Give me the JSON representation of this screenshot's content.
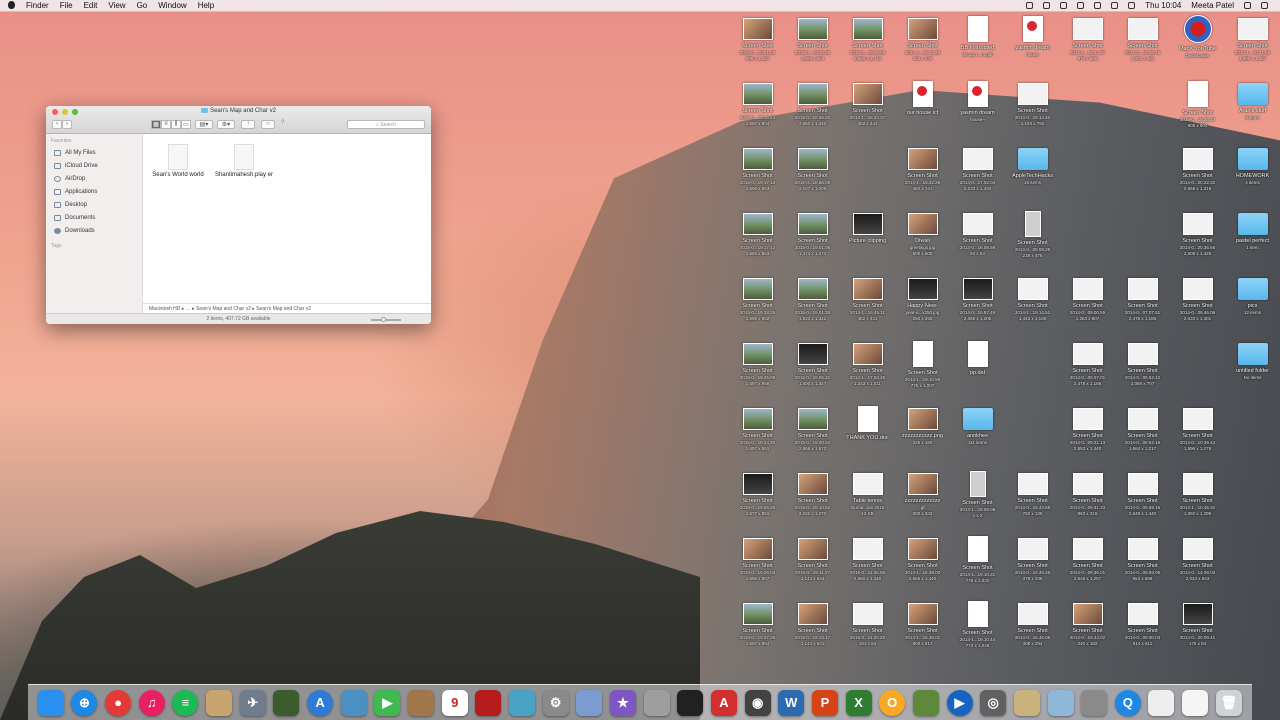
{
  "menubar": {
    "items": [
      "Finder",
      "File",
      "Edit",
      "View",
      "Go",
      "Window",
      "Help"
    ],
    "clock": "Thu 10:04",
    "user": "Meeta Patel"
  },
  "finder": {
    "title": "Sean's Map and Char v2",
    "search_placeholder": "Search",
    "sidebar": {
      "favorites_label": "Favorites",
      "items": [
        "All My Files",
        "iCloud Drive",
        "AirDrop",
        "Applications",
        "Desktop",
        "Documents",
        "Downloads"
      ],
      "tags_label": "Tags"
    },
    "files": [
      "Sean's World world",
      "Shantimahesh.play er"
    ],
    "path": [
      "Macintosh HD",
      "Sean's Map and Char v2",
      "Sean's Map and Char v2"
    ],
    "status": "2 items, 407.72 GB available"
  },
  "desktop_icons": [
    {
      "name": "Screen Shot",
      "sub": "2015-0...20.01.26",
      "dims": "690 x 1,224",
      "kind": "photo"
    },
    {
      "name": "Screen Shot",
      "sub": "2015-0...19.18.25",
      "dims": "1,692 x 954",
      "kind": "screen"
    },
    {
      "name": "Screen Shot",
      "sub": "2015-0...19.19.09",
      "dims": "2,560 x 1,440",
      "kind": "screen"
    },
    {
      "name": "Screen Shot",
      "sub": "2014-1...16.42.28",
      "dims": "482 x 445",
      "kind": "photo"
    },
    {
      "name": "BB Instructed",
      "sub": "Group I...m.pdf",
      "dims": "",
      "kind": "doc"
    },
    {
      "name": "yasmin dream",
      "sub": "house",
      "dims": "",
      "kind": "skp"
    },
    {
      "name": "Screen Shot",
      "sub": "2014-1...16.14.37",
      "dims": "978 x 566",
      "kind": "white"
    },
    {
      "name": "Screen Shot",
      "sub": "2014-0...19.36.45",
      "dims": "1,002 x 482",
      "kind": "white"
    },
    {
      "name": "MacX YouTube",
      "sub": "Downloader",
      "dims": "",
      "kind": "yt"
    },
    {
      "name": "Screen Shot",
      "sub": "2014-1...10.31.58",
      "dims": "1,596 x 1,287",
      "kind": "white"
    },
    {
      "name": "Screen Shot",
      "sub": "2015-0...19.16.54",
      "dims": "1,697 x 904",
      "kind": "screen"
    },
    {
      "name": "Screen Shot",
      "sub": "2015-0...18.55.22",
      "dims": "2,560 x 1,440",
      "kind": "screen"
    },
    {
      "name": "Screen Shot",
      "sub": "2014-1...16.44.37",
      "dims": "482 x 444",
      "kind": "photo"
    },
    {
      "name": "our house ict",
      "sub": "",
      "dims": "",
      "kind": "skp"
    },
    {
      "name": "yasmin dream",
      "sub": "house~",
      "dims": "",
      "kind": "skp"
    },
    {
      "name": "Screen Shot",
      "sub": "2014-0...19.14.40",
      "dims": "1,163 x 792",
      "kind": "white"
    },
    {
      "name": "",
      "sub": "",
      "dims": "",
      "kind": "empty"
    },
    {
      "name": "",
      "sub": "",
      "dims": "",
      "kind": "empty"
    },
    {
      "name": "Screen Shot",
      "sub": "2015-0...15.36.37",
      "dims": "908 x 904",
      "kind": "doc"
    },
    {
      "name": "Aran's stuff",
      "sub": "9 items",
      "dims": "",
      "kind": "folder"
    },
    {
      "name": "Screen Shot",
      "sub": "2015-0...19.17.13",
      "dims": "1,696 x 953",
      "kind": "screen"
    },
    {
      "name": "Screen Shot",
      "sub": "2015-0...18.56.08",
      "dims": "2,107 x 1,209",
      "kind": "screen"
    },
    {
      "name": "",
      "sub": "",
      "dims": "",
      "kind": "empty"
    },
    {
      "name": "Screen Shot",
      "sub": "2014-1...16.42.26",
      "dims": "482 x 741",
      "kind": "photo"
    },
    {
      "name": "Screen Shot",
      "sub": "2014-0...17.02.04",
      "dims": "2,033 x 1,433",
      "kind": "white"
    },
    {
      "name": "AppleTechHacks",
      "sub": "15 items",
      "dims": "",
      "kind": "folder"
    },
    {
      "name": "",
      "sub": "",
      "dims": "",
      "kind": "empty"
    },
    {
      "name": "",
      "sub": "",
      "dims": "",
      "kind": "empty"
    },
    {
      "name": "Screen Shot",
      "sub": "2014-0...20.22.32",
      "dims": "2,658 x 1,319",
      "kind": "white"
    },
    {
      "name": "HOMEWORK",
      "sub": "4 items",
      "dims": "",
      "kind": "folder"
    },
    {
      "name": "Screen Shot",
      "sub": "2015-0...19.17.42",
      "dims": "1,696 x 953",
      "kind": "screen"
    },
    {
      "name": "Screen Shot",
      "sub": "2015-0...19.01.06",
      "dims": "1,474 x 1,273",
      "kind": "screen"
    },
    {
      "name": "Picture clipping",
      "sub": "",
      "dims": "",
      "kind": "dark"
    },
    {
      "name": "Diwali",
      "sub": "greetings.jpg",
      "dims": "500 x 500",
      "kind": "photo"
    },
    {
      "name": "Screen Shot",
      "sub": "2014-0...16.08.58",
      "dims": "94 x 54",
      "kind": "white"
    },
    {
      "name": "Screen Shot",
      "sub": "2014-0...09.08.28",
      "dims": "238 x 475",
      "kind": "tall"
    },
    {
      "name": "",
      "sub": "",
      "dims": "",
      "kind": "empty"
    },
    {
      "name": "",
      "sub": "",
      "dims": "",
      "kind": "empty"
    },
    {
      "name": "Screen Shot",
      "sub": "2014-0...20.36.56",
      "dims": "2,508 x 1,428",
      "kind": "white"
    },
    {
      "name": "pastel perfect",
      "sub": "1 item",
      "dims": "",
      "kind": "folder"
    },
    {
      "name": "Screen Shot",
      "sub": "2015-0...19.18.25",
      "dims": "1,696 x 952",
      "kind": "screen"
    },
    {
      "name": "Screen Shot",
      "sub": "2015-0...19.01.38",
      "dims": "1,533 x 1,341",
      "kind": "screen"
    },
    {
      "name": "Screen Shot",
      "sub": "2014-1...16.45.11",
      "dims": "482 x 431",
      "kind": "photo"
    },
    {
      "name": "Happy-New-",
      "sub": "year-a...x250.jpg",
      "dims": "250 x 250",
      "kind": "dark"
    },
    {
      "name": "Screen Shot",
      "sub": "2014-0...16.57.49",
      "dims": "2,065 x 1,205",
      "kind": "dark"
    },
    {
      "name": "Screen Shot",
      "sub": "2014-1...19.14.51",
      "dims": "1,443 x 1,106",
      "kind": "white"
    },
    {
      "name": "Screen Shot",
      "sub": "2014-0...09.00.59",
      "dims": "1,263 x 807",
      "kind": "white"
    },
    {
      "name": "Screen Shot",
      "sub": "2014-0...07.07.51",
      "dims": "2,476 x 1,186",
      "kind": "white"
    },
    {
      "name": "Screen Shot",
      "sub": "2014-0...08.46.06",
      "dims": "2,033 x 1,301",
      "kind": "white"
    },
    {
      "name": "pics",
      "sub": "12 items",
      "dims": "",
      "kind": "folder"
    },
    {
      "name": "Screen Shot",
      "sub": "2015-0...19.25.09",
      "dims": "1,697 x 956",
      "kind": "screen"
    },
    {
      "name": "Screen Shot",
      "sub": "2015-0...19.05.21",
      "dims": "1,500 x 1,347",
      "kind": "dark"
    },
    {
      "name": "Screen Shot",
      "sub": "2014-1...17.53.45",
      "dims": "1,343 x 1,011",
      "kind": "photo"
    },
    {
      "name": "Screen Shot",
      "sub": "2014-1...19.10.59",
      "dims": "775 x 1,007",
      "kind": "doc"
    },
    {
      "name": "pp.dat",
      "sub": "",
      "dims": "",
      "kind": "doc"
    },
    {
      "name": "",
      "sub": "",
      "dims": "",
      "kind": "empty"
    },
    {
      "name": "Screen Shot",
      "sub": "2014-0...09.07.01",
      "dims": "2,478 x 1,186",
      "kind": "white"
    },
    {
      "name": "Screen Shot",
      "sub": "2014-0...08.52.12",
      "dims": "2,068 x 707",
      "kind": "white"
    },
    {
      "name": "",
      "sub": "",
      "dims": "",
      "kind": "empty"
    },
    {
      "name": "untitled folder",
      "sub": "No items",
      "dims": "",
      "kind": "folder"
    },
    {
      "name": "Screen Shot",
      "sub": "2015-0...19.24.20",
      "dims": "1,697 x 951",
      "kind": "screen"
    },
    {
      "name": "Screen Shot",
      "sub": "2015-0...19.00.52",
      "dims": "2,558 x 1,573",
      "kind": "screen"
    },
    {
      "name": "THANK YOU.doc",
      "sub": "",
      "dims": "",
      "kind": "doc"
    },
    {
      "name": "zzzzzzzzzzz.png",
      "sub": "",
      "dims": "225 x 150",
      "kind": "photo"
    },
    {
      "name": "anokhee",
      "sub": "111 items",
      "dims": "",
      "kind": "folder"
    },
    {
      "name": "",
      "sub": "",
      "dims": "",
      "kind": "empty"
    },
    {
      "name": "Screen Shot",
      "sub": "2014-0...09.21.13",
      "dims": "2,553 x 1,440",
      "kind": "white"
    },
    {
      "name": "Screen Shot",
      "sub": "2014-0...08.52.16",
      "dims": "1,664 x 1,217",
      "kind": "white"
    },
    {
      "name": "Screen Shot",
      "sub": "2014-0...10.39.44",
      "dims": "1,596 x 1,278",
      "kind": "white"
    },
    {
      "name": "",
      "sub": "",
      "dims": "",
      "kind": "empty"
    },
    {
      "name": "Screen Shot",
      "sub": "2015-0...19.25.25",
      "dims": "1,577 x 951",
      "kind": "dark"
    },
    {
      "name": "Screen Shot",
      "sub": "2015-0...18.10.52",
      "dims": "2,231 x 1,270",
      "kind": "photo"
    },
    {
      "name": "Table tennis",
      "sub": "tourna...ian 2015",
      "dims": "12 KB",
      "kind": "white"
    },
    {
      "name": "zzzzzzzzzzzzz",
      "sub": ".gif",
      "dims": "500 x 333",
      "kind": "photo"
    },
    {
      "name": "Screen Shot",
      "sub": "2014-1...19.09.08",
      "dims": "1 x 2",
      "kind": "tall"
    },
    {
      "name": "Screen Shot",
      "sub": "2014-0...16.43.58",
      "dims": "760 x 136",
      "kind": "white"
    },
    {
      "name": "Screen Shot",
      "sub": "2014-0...09.31.33",
      "dims": "963 x 215",
      "kind": "white"
    },
    {
      "name": "Screen Shot",
      "sub": "2014-0...08.59.16",
      "dims": "2,548 x 1,440",
      "kind": "white"
    },
    {
      "name": "Screen Shot",
      "sub": "2014-1...10.45.32",
      "dims": "1,892 x 1,299",
      "kind": "white"
    },
    {
      "name": "",
      "sub": "",
      "dims": "",
      "kind": "empty"
    },
    {
      "name": "Screen Shot",
      "sub": "2015-0...19.26.03",
      "dims": "1,696 x 957",
      "kind": "photo"
    },
    {
      "name": "Screen Shot",
      "sub": "2015-0...19.11.37",
      "dims": "1,143 x 644",
      "kind": "photo"
    },
    {
      "name": "Screen Shot",
      "sub": "2015-0...11.25.05",
      "dims": "2,560 x 1,440",
      "kind": "white"
    },
    {
      "name": "Screen Shot",
      "sub": "2014-1...16.38.00",
      "dims": "2,556 x 1,440",
      "kind": "photo"
    },
    {
      "name": "Screen Shot",
      "sub": "2014-1...19.10.31",
      "dims": "775 x 1,032",
      "kind": "doc"
    },
    {
      "name": "Screen Shot",
      "sub": "2014-0...16.45.46",
      "dims": "378 x 235",
      "kind": "white"
    },
    {
      "name": "Screen Shot",
      "sub": "2014-0...09.36.01",
      "dims": "2,545 x 1,257",
      "kind": "white"
    },
    {
      "name": "Screen Shot",
      "sub": "2014-0...08.59.06",
      "dims": "654 x 658",
      "kind": "white"
    },
    {
      "name": "Screen Shot",
      "sub": "2014-0...14.09.03",
      "dims": "2,034 x 943",
      "kind": "white"
    },
    {
      "name": "",
      "sub": "",
      "dims": "",
      "kind": "empty"
    },
    {
      "name": "Screen Shot",
      "sub": "2015-0...19.27.25",
      "dims": "1,697 x 954",
      "kind": "screen"
    },
    {
      "name": "Screen Shot",
      "sub": "2015-0...19.14.17",
      "dims": "1,143 x 641",
      "kind": "photo"
    },
    {
      "name": "Screen Shot",
      "sub": "2015-0...11.25.28",
      "dims": "181 x 84",
      "kind": "white"
    },
    {
      "name": "Screen Shot",
      "sub": "2014-1...16.38.01",
      "dims": "800 x 817",
      "kind": "photo"
    },
    {
      "name": "Screen Shot",
      "sub": "2014-1...19.10.44",
      "dims": "772 x 1,026",
      "kind": "doc"
    },
    {
      "name": "Screen Shot",
      "sub": "2014-0...16.46.06",
      "dims": "308 x 294",
      "kind": "white"
    },
    {
      "name": "Screen Shot",
      "sub": "2014-0...19.44.02",
      "dims": "240 x 182",
      "kind": "photo"
    },
    {
      "name": "Screen Shot",
      "sub": "2014-0...09.00.03",
      "dims": "614 x 611",
      "kind": "white"
    },
    {
      "name": "Screen Shot",
      "sub": "2014-0...20.09.41",
      "dims": "175 x 84",
      "kind": "dark"
    },
    {
      "name": "",
      "sub": "",
      "dims": "",
      "kind": "empty"
    }
  ],
  "dock": [
    {
      "name": "finder-icon",
      "color": "#2b8ff0",
      "glyph": ""
    },
    {
      "name": "safari-icon",
      "color": "#1e88e5",
      "glyph": "⊕"
    },
    {
      "name": "chrome-icon",
      "color": "#e53935",
      "glyph": "●"
    },
    {
      "name": "itunes-icon",
      "color": "#e91e63",
      "glyph": "♫"
    },
    {
      "name": "spotify-icon",
      "color": "#1db954",
      "glyph": "≡"
    },
    {
      "name": "notes-icon",
      "color": "#c8a46e",
      "glyph": ""
    },
    {
      "name": "launchpad-icon",
      "color": "#6f7c8c",
      "glyph": "✈"
    },
    {
      "name": "minecraft-icon",
      "color": "#3d5c2e",
      "glyph": ""
    },
    {
      "name": "appstore-icon",
      "color": "#2e7bd6",
      "glyph": "A"
    },
    {
      "name": "preview-icon",
      "color": "#4a90c2",
      "glyph": ""
    },
    {
      "name": "facetime-icon",
      "color": "#3fb950",
      "glyph": "▶"
    },
    {
      "name": "contacts-icon",
      "color": "#a0764a",
      "glyph": ""
    },
    {
      "name": "calendar-icon",
      "color": "#ffffff",
      "glyph": "9"
    },
    {
      "name": "photobooth-icon",
      "color": "#b71c1c",
      "glyph": ""
    },
    {
      "name": "iphoto-icon",
      "color": "#4aa3c7",
      "glyph": ""
    },
    {
      "name": "system-preferences-icon",
      "color": "#8a8a8a",
      "glyph": "⚙"
    },
    {
      "name": "image-capture-icon",
      "color": "#7b9bd1",
      "glyph": ""
    },
    {
      "name": "imovie-icon",
      "color": "#7e57c2",
      "glyph": "★"
    },
    {
      "name": "printer-icon",
      "color": "#9e9e9e",
      "glyph": ""
    },
    {
      "name": "camera-icon",
      "color": "#212121",
      "glyph": ""
    },
    {
      "name": "acrobat-icon",
      "color": "#d32f2f",
      "glyph": "A"
    },
    {
      "name": "webcam-icon",
      "color": "#424242",
      "glyph": "◉"
    },
    {
      "name": "word-icon",
      "color": "#2b6cb0",
      "glyph": "W"
    },
    {
      "name": "powerpoint-icon",
      "color": "#d84315",
      "glyph": "P"
    },
    {
      "name": "excel-icon",
      "color": "#2e7d32",
      "glyph": "X"
    },
    {
      "name": "outlook-icon",
      "color": "#f9a825",
      "glyph": "O"
    },
    {
      "name": "minecraft-block-icon",
      "color": "#5d8a3a",
      "glyph": ""
    },
    {
      "name": "youtube-downloader-icon",
      "color": "#1565c0",
      "glyph": "▶"
    },
    {
      "name": "screenshot-icon",
      "color": "#616161",
      "glyph": "◎"
    },
    {
      "name": "photos-folder-icon",
      "color": "#c9b27c",
      "glyph": ""
    },
    {
      "name": "documents-folder-icon",
      "color": "#8fb8d8",
      "glyph": ""
    },
    {
      "name": "downloads-folder-icon",
      "color": "#8a8a8a",
      "glyph": ""
    },
    {
      "name": "quicktime-icon",
      "color": "#1e88e5",
      "glyph": "Q"
    },
    {
      "name": "doc-stack-icon",
      "color": "#eeeeee",
      "glyph": ""
    },
    {
      "name": "doc-file-icon",
      "color": "#f5f5f5",
      "glyph": ""
    },
    {
      "name": "trash-icon",
      "color": "#cfd2d6",
      "glyph": "🗑"
    }
  ]
}
